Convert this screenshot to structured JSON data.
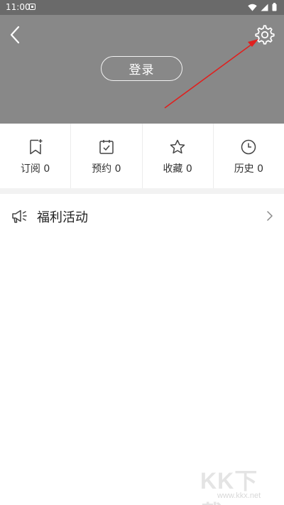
{
  "status_bar": {
    "time": "11:00"
  },
  "header": {
    "login_label": "登录"
  },
  "stats": [
    {
      "label": "订阅",
      "count": "0",
      "icon": "bookmark-add-icon"
    },
    {
      "label": "预约",
      "count": "0",
      "icon": "calendar-check-icon"
    },
    {
      "label": "收藏",
      "count": "0",
      "icon": "star-icon"
    },
    {
      "label": "历史",
      "count": "0",
      "icon": "clock-icon"
    }
  ],
  "welfare": {
    "label": "福利活动",
    "icon": "megaphone-icon"
  },
  "watermark": {
    "logo": "KK下载",
    "url": "www.kkx.net"
  },
  "colors": {
    "header_bg": "#888888",
    "annotation_arrow": "#e0201e"
  }
}
